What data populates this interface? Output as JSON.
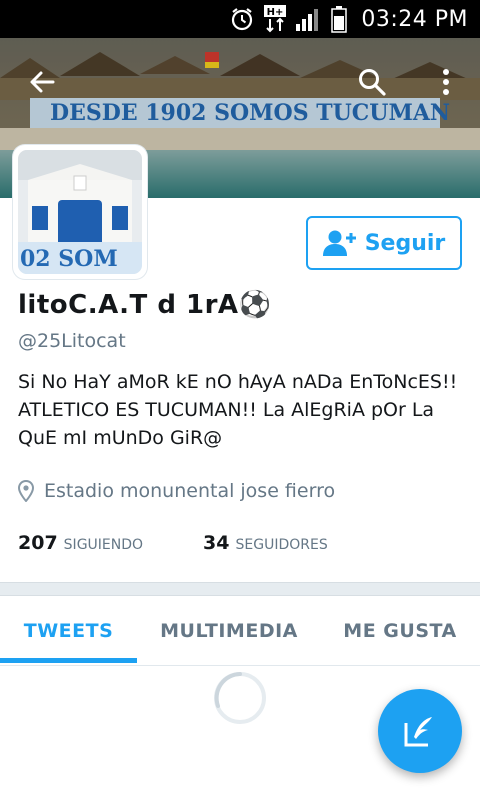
{
  "status_bar": {
    "time": "03:24 PM",
    "icons": [
      "alarm-icon",
      "data-transfer-icon",
      "signal-icon",
      "battery-icon"
    ],
    "data_badge": "H+"
  },
  "header": {
    "banner_text": "DESDE 1902  SOMOS TUCUMAN",
    "back_icon": "arrow-left-icon",
    "search_icon": "search-icon",
    "more_icon": "more-vert-icon"
  },
  "avatar": {
    "banner_text": "02  SOM"
  },
  "follow_button": {
    "label": "Seguir",
    "icon": "add-user-icon"
  },
  "profile": {
    "name": "litoC.A.T d 1rA⚽",
    "handle": "@25Litocat",
    "bio": "Si No HaY aMoR kE nO hAyA nADa EnToNcES!! ATLETICO ES TUCUMAN!! La AlEgRiA pOr La QuE mI mUnDo GiR@",
    "location": "Estadio monunental jose fierro",
    "following_count": "207",
    "following_label": "SIGUIENDO",
    "followers_count": "34",
    "followers_label": "SEGUIDORES"
  },
  "tabs": [
    {
      "label": "TWEETS",
      "active": true
    },
    {
      "label": "MULTIMEDIA",
      "active": false
    },
    {
      "label": "ME GUSTA",
      "active": false
    }
  ],
  "colors": {
    "accent": "#1da1f2",
    "text": "#14171a",
    "muted": "#657786"
  },
  "fab": {
    "icon": "compose-tweet-icon"
  }
}
